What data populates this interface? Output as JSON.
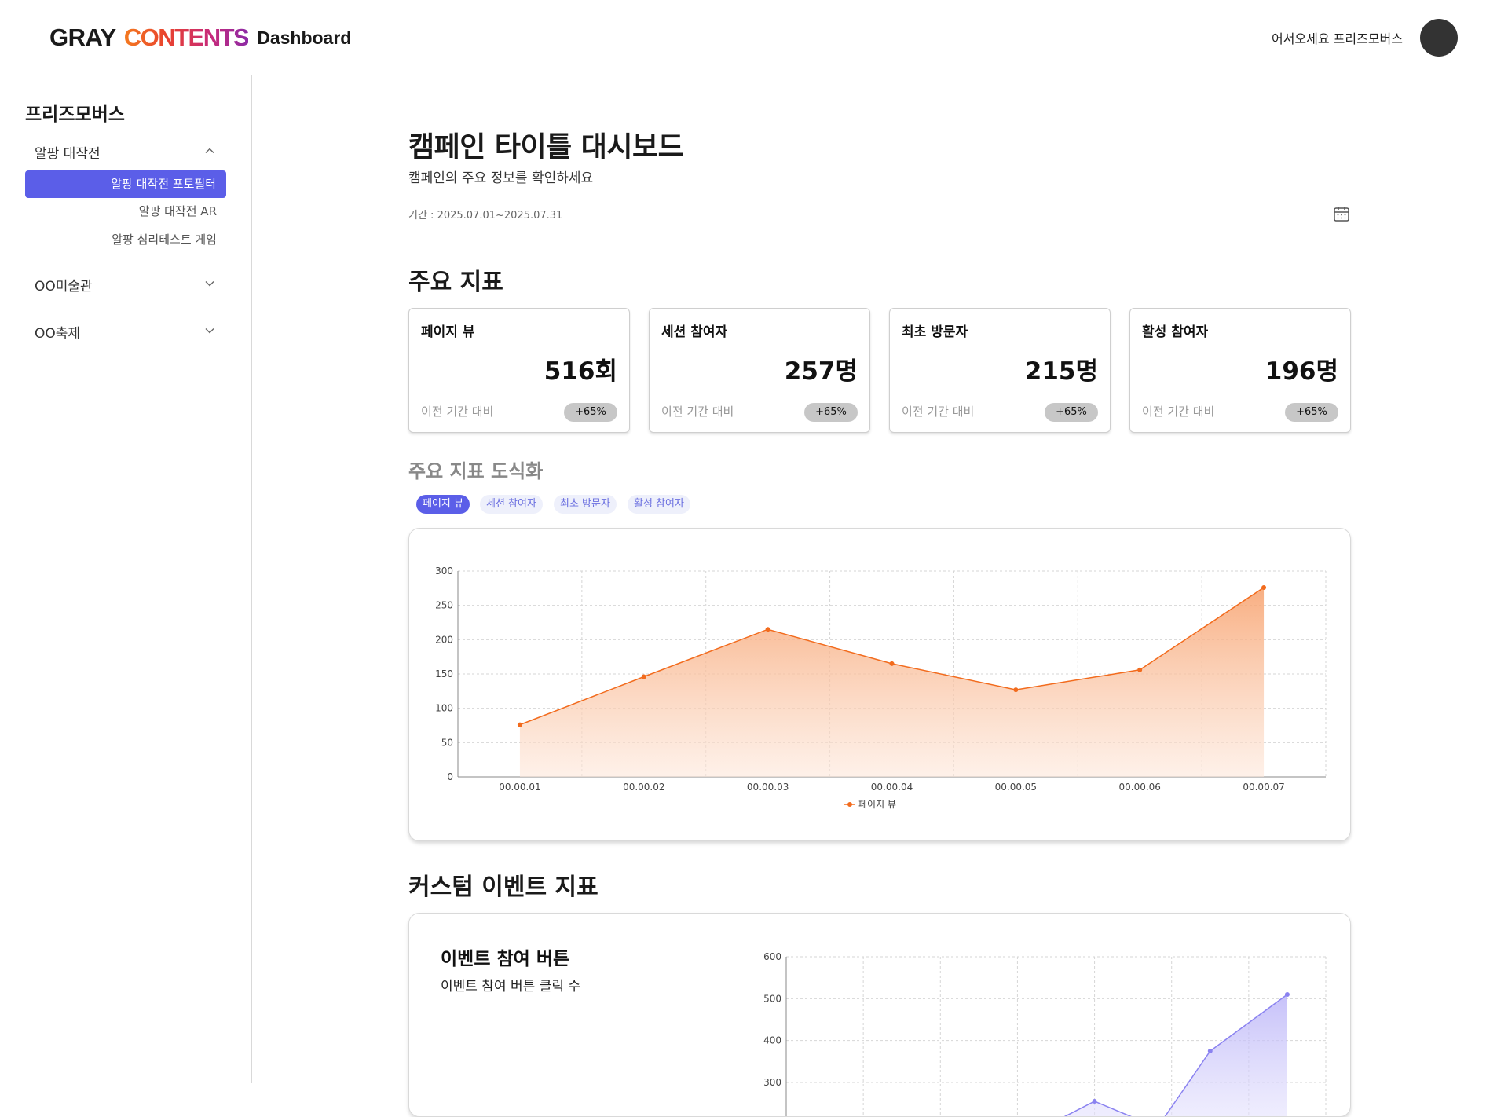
{
  "header": {
    "logo_gray": "GRAY",
    "logo_contents": "CONTENTS",
    "logo_dashboard": "Dashboard",
    "greeting": "어서오세요 프리즈모버스"
  },
  "sidebar": {
    "org_name": "프리즈모버스",
    "groups": [
      {
        "label": "알팡 대작전",
        "expanded": true,
        "items": [
          {
            "label": "알팡 대작전 포토필터",
            "active": true
          },
          {
            "label": "알팡 대작전 AR",
            "active": false
          },
          {
            "label": "알팡 심리테스트 게임",
            "active": false
          }
        ]
      },
      {
        "label": "OO미술관",
        "expanded": false
      },
      {
        "label": "OO축제",
        "expanded": false
      }
    ]
  },
  "main": {
    "title": "캠페인 타이틀 대시보드",
    "subtitle": "캠페인의 주요 정보를 확인하세요",
    "period": "기간 : 2025.07.01~2025.07.31",
    "kpi_section_title": "주요 지표",
    "kpis": [
      {
        "label": "페이지 뷰",
        "value": "516회",
        "compare": "이전 기간 대비",
        "change": "+65%"
      },
      {
        "label": "세션 참여자",
        "value": "257명",
        "compare": "이전 기간 대비",
        "change": "+65%"
      },
      {
        "label": "최초 방문자",
        "value": "215명",
        "compare": "이전 기간 대비",
        "change": "+65%"
      },
      {
        "label": "활성 참여자",
        "value": "196명",
        "compare": "이전 기간 대비",
        "change": "+65%"
      }
    ],
    "viz_title": "주요 지표 도식화",
    "chips": [
      {
        "label": "페이지 뷰",
        "active": true
      },
      {
        "label": "세션 참여자",
        "active": false
      },
      {
        "label": "최초 방문자",
        "active": false
      },
      {
        "label": "활성 참여자",
        "active": false
      }
    ],
    "custom_section_title": "커스텀 이벤트 지표",
    "event_card": {
      "title": "이벤트 참여 버튼",
      "subtitle": "이벤트 참여 버튼 클릭 수"
    }
  },
  "colors": {
    "accent": "#5b5ee8",
    "line_orange": "#f26b1d",
    "line_purple": "#8a82f0"
  },
  "chart_data": [
    {
      "type": "area",
      "categories": [
        "00.00.01",
        "00.00.02",
        "00.00.03",
        "00.00.04",
        "00.00.05",
        "00.00.06",
        "00.00.07"
      ],
      "series": [
        {
          "name": "페이지 뷰",
          "values": [
            76,
            146,
            215,
            165,
            127,
            156,
            276
          ]
        }
      ],
      "yticks": [
        0,
        50,
        100,
        150,
        200,
        250,
        300
      ],
      "ylim": [
        0,
        300
      ],
      "grid": true,
      "legend": "bottom"
    },
    {
      "type": "area",
      "yticks": [
        300,
        400,
        500,
        600
      ],
      "ylim": [
        0,
        600
      ],
      "points": [
        {
          "x_index": 3.5,
          "y": 255
        },
        {
          "x_index": 5.0,
          "y": 375
        },
        {
          "x_index": 6.0,
          "y": 510
        }
      ],
      "grid": true
    }
  ]
}
